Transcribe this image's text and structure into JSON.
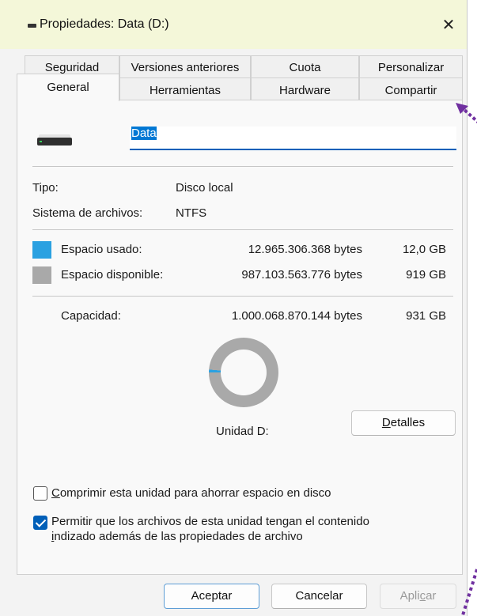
{
  "window": {
    "title": "Propiedades: Data (D:)",
    "close_glyph": "✕"
  },
  "tabs": {
    "row1": [
      "Seguridad",
      "Versiones anteriores",
      "Cuota",
      "Personalizar"
    ],
    "row2": [
      "General",
      "Herramientas",
      "Hardware",
      "Compartir"
    ],
    "active": "General"
  },
  "general": {
    "drive_name": "Data",
    "type_label": "Tipo:",
    "type_value": "Disco local",
    "fs_label": "Sistema de archivos:",
    "fs_value": "NTFS",
    "used": {
      "label": "Espacio usado:",
      "bytes": "12.965.306.368 bytes",
      "size": "12,0 GB",
      "color": "#2aa1e1"
    },
    "free": {
      "label": "Espacio disponible:",
      "bytes": "987.103.563.776 bytes",
      "size": "919 GB",
      "color": "#a9a9a9"
    },
    "capacity": {
      "label": "Capacidad:",
      "bytes": "1.000.068.870.144 bytes",
      "size": "931 GB"
    },
    "used_fraction": 0.013,
    "drive_label": "Unidad D:",
    "details": {
      "pre": "",
      "accel": "D",
      "post": "etalles"
    }
  },
  "options": {
    "compress": {
      "pre": "",
      "accel": "C",
      "post": "omprimir esta unidad para ahorrar espacio en disco",
      "checked": false
    },
    "index": {
      "line1": "Permitir que los archivos de esta unidad tengan el contenido",
      "line2_pre": "",
      "line2_accel": "i",
      "line2_post": "ndizado además de las propiedades de archivo",
      "checked": true
    }
  },
  "buttons": {
    "ok": "Aceptar",
    "cancel": "Cancelar",
    "apply": {
      "pre": "Apli",
      "accel": "c",
      "post": "ar"
    }
  },
  "icons": {
    "drive": "hard-drive-icon",
    "close": "close-icon",
    "window": "drive-window-icon"
  },
  "colors": {
    "accent": "#005fb8",
    "titlebar": "#f4f7d9",
    "annotation": "#7030a0"
  }
}
